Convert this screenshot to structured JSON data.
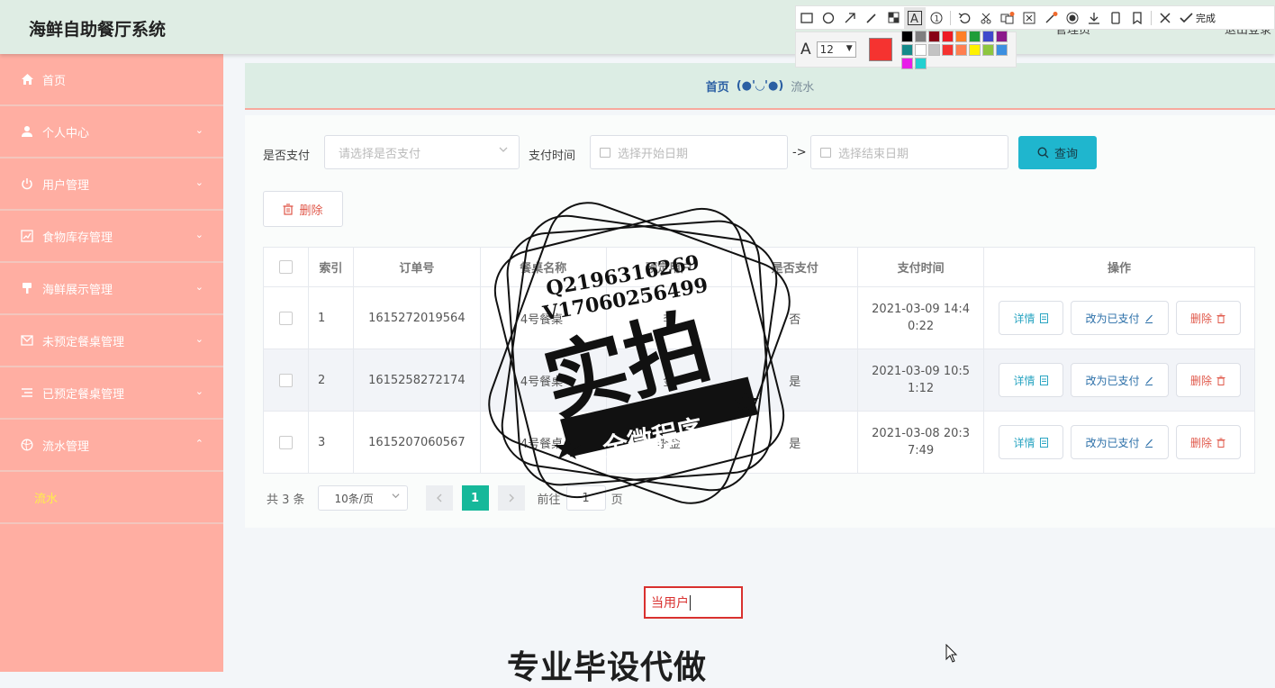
{
  "header": {
    "brand": "海鲜自助餐厅系统",
    "user": "管理员",
    "logout": "退出登录"
  },
  "sidebar": {
    "items": [
      {
        "label": "首页",
        "icon": "home-icon",
        "arrow": ""
      },
      {
        "label": "个人中心",
        "icon": "user-icon",
        "arrow": "⌄"
      },
      {
        "label": "用户管理",
        "icon": "power-icon",
        "arrow": "⌄"
      },
      {
        "label": "食物库存管理",
        "icon": "chart-icon",
        "arrow": "⌄"
      },
      {
        "label": "海鲜展示管理",
        "icon": "brush-icon",
        "arrow": "⌄"
      },
      {
        "label": "未预定餐桌管理",
        "icon": "mail-icon",
        "arrow": "⌄"
      },
      {
        "label": "已预定餐桌管理",
        "icon": "list-icon",
        "arrow": "⌄"
      },
      {
        "label": "流水管理",
        "icon": "ball-icon",
        "arrow": "⌃"
      }
    ],
    "sub_item": "流水"
  },
  "breadcrumb": {
    "home": "首页",
    "face": "(●'◡'●)",
    "current": "流水"
  },
  "filter": {
    "paid_label": "是否支付",
    "paid_placeholder": "请选择是否支付",
    "time_label": "支付时间",
    "start_placeholder": "选择开始日期",
    "separator": "->",
    "end_placeholder": "选择结束日期",
    "query_label": "查询",
    "delete_label": "删除"
  },
  "table": {
    "headers": [
      "索引",
      "订单号",
      "餐桌名称",
      "预定用户",
      "是否支付",
      "支付时间",
      "操作"
    ],
    "rows": [
      {
        "index": "1",
        "order": "1615272019564",
        "table": "4号餐桌",
        "user": "李",
        "paid": "否",
        "time1": "2021-03-09 14:4",
        "time2": "0:22"
      },
      {
        "index": "2",
        "order": "1615258272174",
        "table": "4号餐桌",
        "user": "金",
        "paid": "是",
        "time1": "2021-03-09 10:5",
        "time2": "1:12"
      },
      {
        "index": "3",
        "order": "1615207060567",
        "table": "4号餐桌",
        "user": "李金",
        "paid": "是",
        "time1": "2021-03-08 20:3",
        "time2": "7:49"
      }
    ],
    "op_detail": "详情",
    "op_pay": "改为已支付",
    "op_delete": "删除"
  },
  "pager": {
    "total": "共 3 条",
    "size": "10条/页",
    "current": "1",
    "goto_prefix": "前往",
    "goto_value": "1",
    "goto_suffix": "页"
  },
  "stamp": {
    "line1": "Q2196316269",
    "line2": "V17060256499",
    "big": "实拍",
    "ribbon": "全微程序"
  },
  "overlay": {
    "input_text": "当用户",
    "watermark": "专业毕设代做"
  },
  "toolbar": {
    "done": "完成",
    "font_size": "12",
    "current_color": "#f53330"
  },
  "palette": [
    "#000000",
    "#7f7f7f",
    "#880015",
    "#ed1c24",
    "#ff7f27",
    "#1f9d39",
    "#3f48cc",
    "#8b1a8b",
    "#158a8a",
    "#ffffff",
    "#c3c3c3",
    "#f53330",
    "#ff7f50",
    "#fff200",
    "#8dc63f",
    "#3c8fe0",
    "#e81ee8",
    "#22d0d0"
  ]
}
